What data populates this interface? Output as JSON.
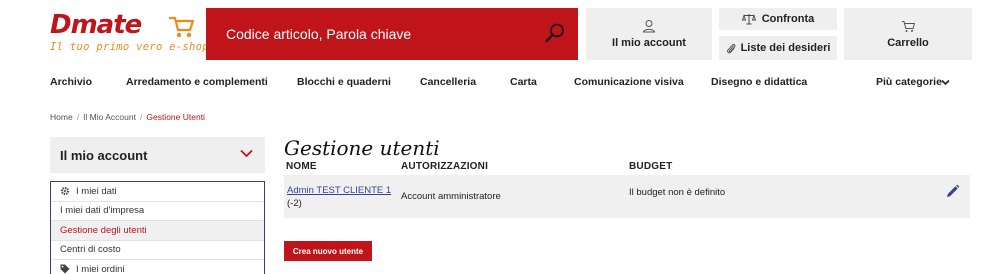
{
  "brand": {
    "name": "Dmate",
    "tagline": "Il tuo primo vero e-shop",
    "primary_color": "#c0141b",
    "accent_color": "#f08a1c"
  },
  "header": {
    "search_placeholder": "Codice articolo, Parola chiave",
    "search_icon": "search-icon",
    "account_label": "Il mio account",
    "compare_label": "Confronta",
    "wishlist_label": "Liste dei desideri",
    "cart_label": "Carrello"
  },
  "nav": {
    "items": [
      "Archivio",
      "Arredamento e complementi",
      "Blocchi e quaderni",
      "Cancelleria",
      "Carta",
      "Comunicazione visiva",
      "Disegno e didattica"
    ],
    "more_label": "Più categorie"
  },
  "breadcrumb": {
    "items": [
      "Home",
      "Il Mio Account"
    ],
    "current": "Gestione Utenti"
  },
  "sidebar": {
    "title": "Il mio account",
    "items": [
      {
        "label": "I miei dati",
        "icon": "gear-icon",
        "group": true
      },
      {
        "label": "I miei dati d'impresa"
      },
      {
        "label": "Gestione degli utenti",
        "active": true
      },
      {
        "label": "Centri di costo"
      },
      {
        "label": "I miei ordini",
        "icon": "tag-icon",
        "group": true
      }
    ]
  },
  "main": {
    "title": "Gestione utenti",
    "columns": [
      "NOME",
      "AUTORIZZAZIONI",
      "BUDGET"
    ],
    "rows": [
      {
        "name": "Admin TEST CLIENTE 1",
        "id": "(-2)",
        "authorization": "Account amministratore",
        "budget": "Il budget non è definito"
      }
    ],
    "create_button": "Crea nuovo utente"
  }
}
